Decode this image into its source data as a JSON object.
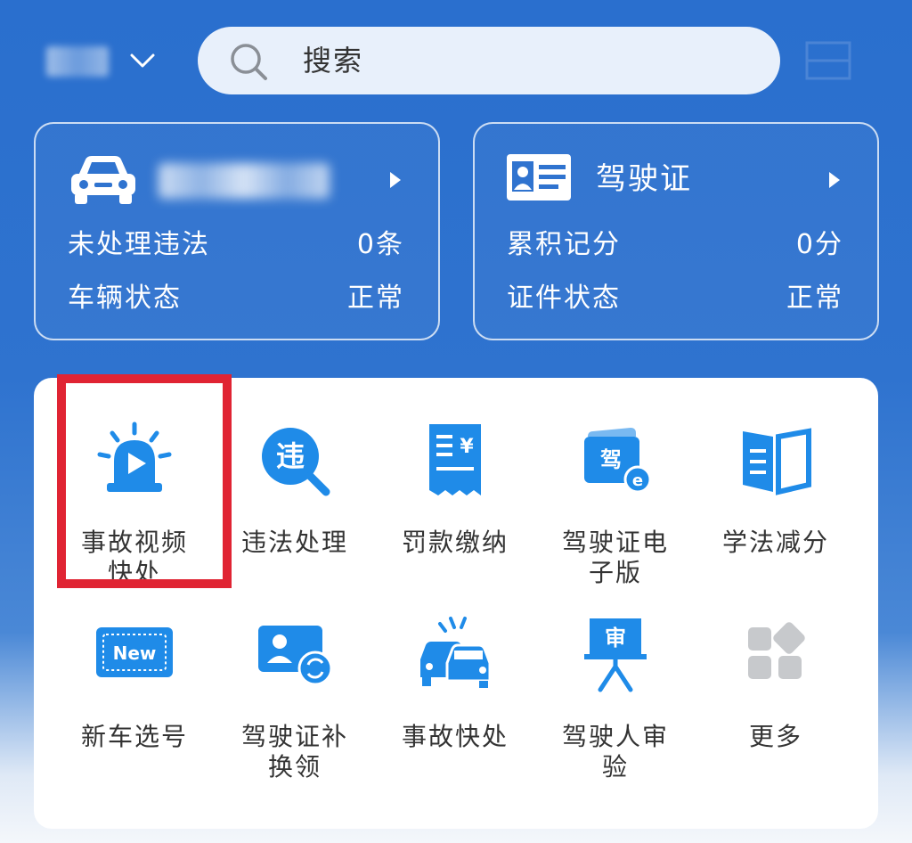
{
  "header": {
    "search_placeholder": "搜索"
  },
  "vehicle_card": {
    "rows": [
      {
        "label": "未处理违法",
        "value": "0条"
      },
      {
        "label": "车辆状态",
        "value": "正常"
      }
    ]
  },
  "license_card": {
    "title": "驾驶证",
    "rows": [
      {
        "label": "累积记分",
        "value": "0分"
      },
      {
        "label": "证件状态",
        "value": "正常"
      }
    ]
  },
  "services": [
    {
      "label": "事故视频快处",
      "icon": "siren-video-icon"
    },
    {
      "label": "违法处理",
      "icon": "violation-search-icon"
    },
    {
      "label": "罚款缴纳",
      "icon": "fine-receipt-icon"
    },
    {
      "label": "驾驶证电子版",
      "icon": "e-license-icon"
    },
    {
      "label": "学法减分",
      "icon": "open-book-icon"
    },
    {
      "label": "新车选号",
      "icon": "new-plate-icon"
    },
    {
      "label": "驾驶证补换领",
      "icon": "license-replace-icon"
    },
    {
      "label": "事故快处",
      "icon": "car-collision-icon"
    },
    {
      "label": "驾驶人审验",
      "icon": "driver-review-icon"
    },
    {
      "label": "更多",
      "icon": "more-grid-icon"
    }
  ],
  "colors": {
    "primary_blue": "#2a6fce",
    "icon_blue": "#1f8be8",
    "highlight_red": "#e02433",
    "more_gray": "#c7c9cc"
  }
}
